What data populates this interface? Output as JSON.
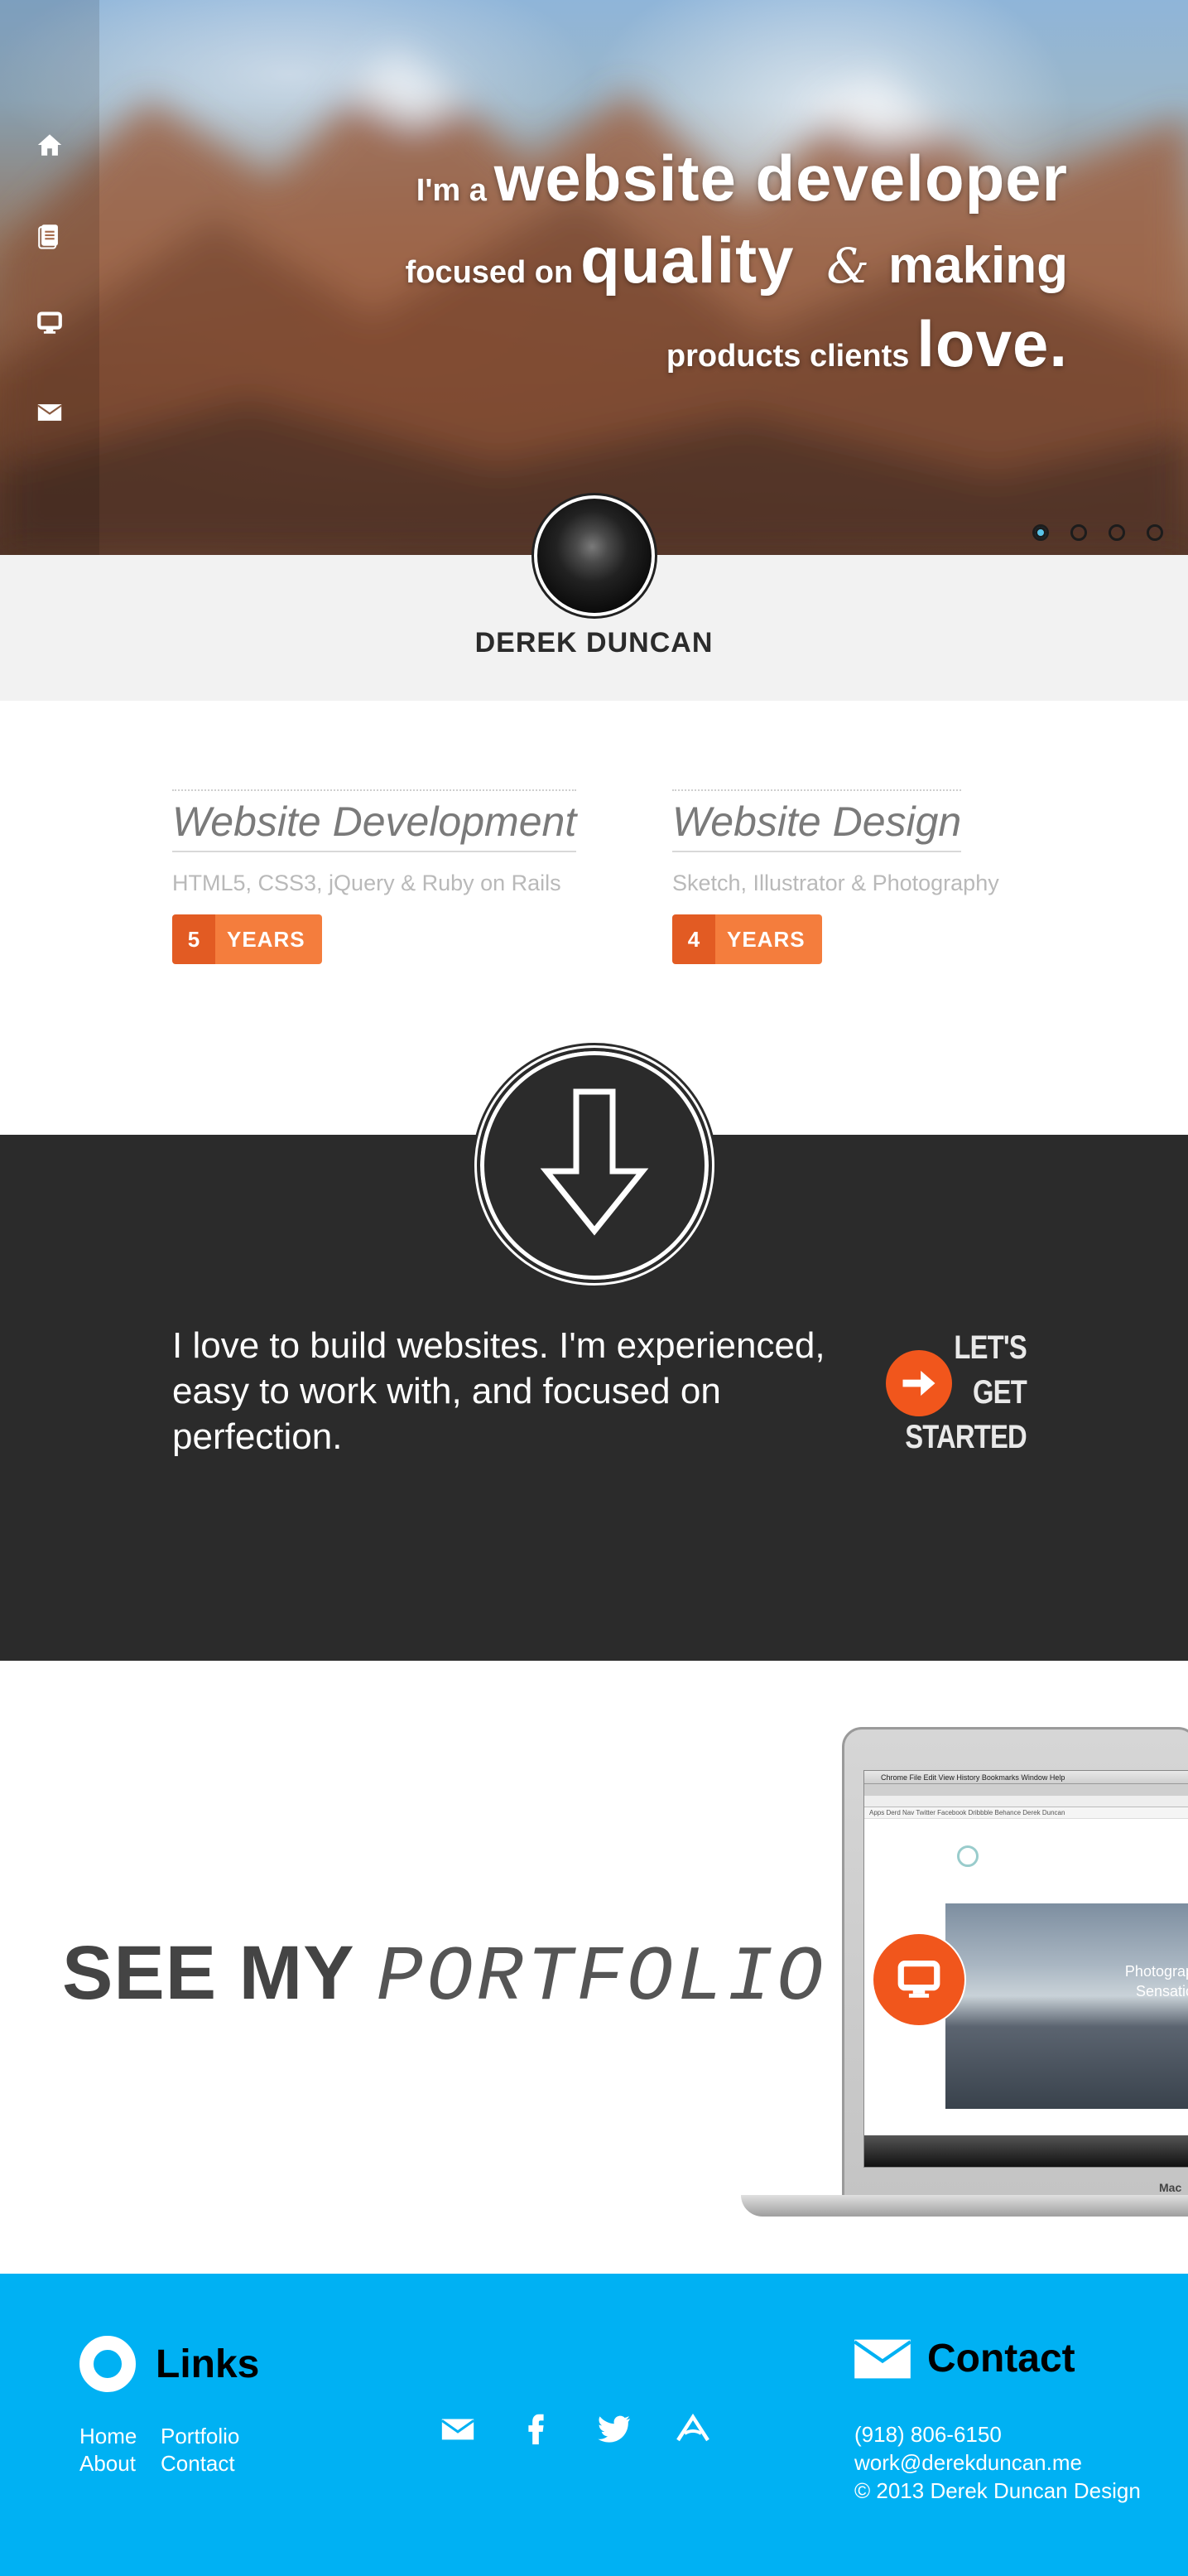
{
  "nav": {
    "items": [
      {
        "icon": "home-icon"
      },
      {
        "icon": "document-icon"
      },
      {
        "icon": "monitor-icon"
      },
      {
        "icon": "mail-icon"
      }
    ]
  },
  "hero": {
    "line1_small": "I'm a",
    "line1_big": "website developer",
    "line2_small": "focused on",
    "line2_big": "quality",
    "line2_amp": "&",
    "line2_mid": "making",
    "line3_small": "products clients",
    "line3_big": "love.",
    "slides": 4,
    "active_slide": 1
  },
  "profile": {
    "name": "DEREK DUNCAN"
  },
  "skills": [
    {
      "title": "Website Development",
      "tech": "HTML5,  CSS3,  jQuery & Ruby on Rails",
      "years": "5",
      "years_label": "YEARS"
    },
    {
      "title": "Website Design",
      "tech": "Sketch, Illustrator & Photography",
      "years": "4",
      "years_label": "YEARS"
    }
  ],
  "pitch": {
    "text": "I love to build websites.  I'm experienced, easy to work with, and focused on perfection.",
    "cta_line1": "LET'S",
    "cta_line2": "GET",
    "cta_line3": "STARTED"
  },
  "portfolio": {
    "see": "SEE MY",
    "portfolio": "PORTFOLIO",
    "laptop_mac": "Mac",
    "screen_menubar": "Chrome   File   Edit   View   History   Bookmarks   Window   Help",
    "screen_bookmarks": "Apps  Derd Nav  Twitter  Facebook  Dribbble  Behance  Derek Duncan",
    "screen_photo_text1": "Photograph",
    "screen_photo_text2": "Sensation"
  },
  "footer": {
    "links_title": "Links",
    "links": [
      "Home",
      "Portfolio",
      "About",
      "Contact"
    ],
    "contact_title": "Contact",
    "phone": "(918) 806-6150",
    "email": "work@derekduncan.me",
    "copyright": "© 2013 Derek Duncan Design",
    "social": [
      {
        "icon": "mail-icon"
      },
      {
        "icon": "facebook-icon"
      },
      {
        "icon": "twitter-icon"
      },
      {
        "icon": "app-net-icon"
      }
    ]
  },
  "colors": {
    "accent_orange": "#f1561c",
    "footer_blue": "#00b1f3",
    "dark_bg": "#2b2b2b",
    "active_dot": "#59c4e9"
  }
}
